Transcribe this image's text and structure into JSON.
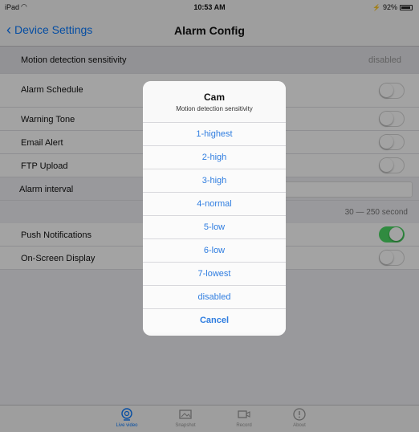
{
  "status_bar": {
    "carrier": "iPad",
    "time": "10:53 AM",
    "battery": "92%"
  },
  "nav": {
    "back_label": "Device Settings",
    "title": "Alarm Config"
  },
  "settings": {
    "motion_sensitivity": {
      "label": "Motion detection sensitivity",
      "value": "disabled"
    },
    "alarm_schedule": {
      "label": "Alarm Schedule",
      "on": false
    },
    "warning_tone": {
      "label": "Warning Tone",
      "on": false
    },
    "email_alert": {
      "label": "Email Alert",
      "on": false
    },
    "ftp_upload": {
      "label": "FTP Upload",
      "on": false
    },
    "alarm_interval": {
      "label": "Alarm interval",
      "value": "",
      "hint": "30 — 250 second"
    },
    "push_notifications": {
      "label": "Push Notifications",
      "on": true
    },
    "on_screen_display": {
      "label": "On-Screen Display",
      "on": false
    }
  },
  "action_sheet": {
    "title": "Cam",
    "subtitle": "Motion detection sensitivity",
    "options": [
      "1-highest",
      "2-high",
      "3-high",
      "4-normal",
      "5-low",
      "6-low",
      "7-lowest",
      "disabled"
    ],
    "cancel_label": "Cancel"
  },
  "tab_bar": {
    "tabs": [
      {
        "label": "Live video",
        "icon": "camera-icon",
        "active": true
      },
      {
        "label": "Snapshot",
        "icon": "photo-icon",
        "active": false
      },
      {
        "label": "Record",
        "icon": "video-icon",
        "active": false
      },
      {
        "label": "About",
        "icon": "info-icon",
        "active": false
      }
    ]
  },
  "colors": {
    "accent": "#0a7aff",
    "toggle_on": "#4cd964",
    "sheet_text": "#2f7de0"
  }
}
